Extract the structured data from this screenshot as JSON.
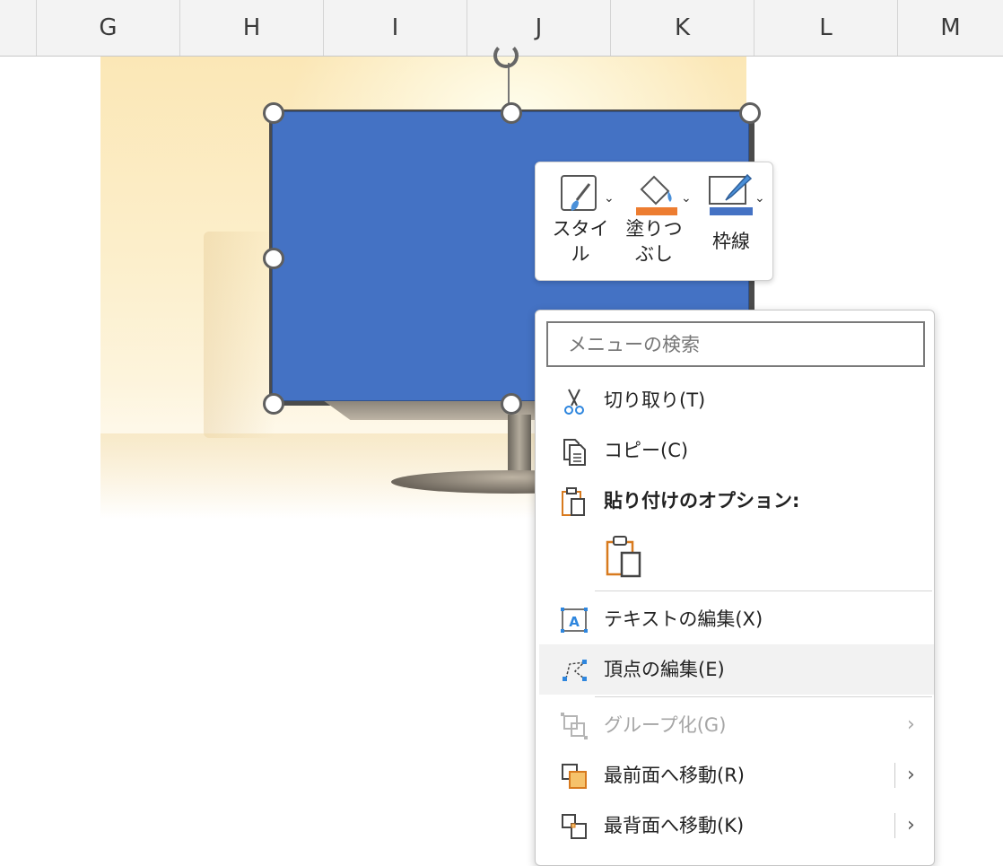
{
  "columns": [
    "G",
    "H",
    "I",
    "J",
    "K",
    "L",
    "M"
  ],
  "mini_toolbar": {
    "style_label": "スタイル",
    "fill_label": "塗りつぶし",
    "outline_label": "枠線",
    "fill_color": "#ed7d31",
    "outline_color": "#4472c4"
  },
  "shape": {
    "fill_color": "#4472c4"
  },
  "context_menu": {
    "search_placeholder": "メニューの検索",
    "items": [
      {
        "label": "切り取り(T)",
        "icon": "scissors-icon",
        "enabled": true
      },
      {
        "label": "コピー(C)",
        "icon": "copy-icon",
        "enabled": true
      },
      {
        "label": "貼り付けのオプション:",
        "icon": "paste-icon",
        "enabled": true,
        "header": true
      },
      {
        "label": "テキストの編集(X)",
        "icon": "edit-text-icon",
        "enabled": true
      },
      {
        "label": "頂点の編集(E)",
        "icon": "edit-points-icon",
        "enabled": true,
        "highlighted": true
      },
      {
        "label": "グループ化(G)",
        "icon": "group-icon",
        "enabled": false,
        "submenu": true
      },
      {
        "label": "最前面へ移動(R)",
        "icon": "bring-to-front-icon",
        "enabled": true,
        "submenu": true
      },
      {
        "label": "最背面へ移動(K)",
        "icon": "send-to-back-icon",
        "enabled": true,
        "submenu": true
      }
    ],
    "paste_options": [
      "paste-keep-source-icon"
    ]
  }
}
